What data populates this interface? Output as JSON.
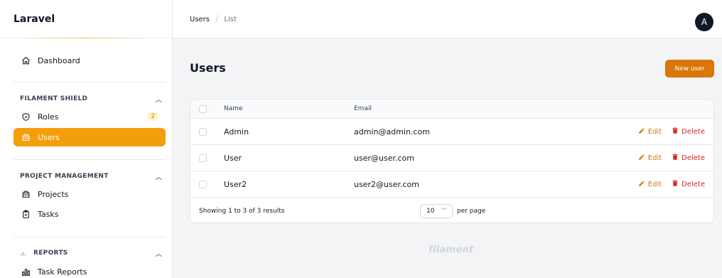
{
  "brand": "Laravel",
  "sidebar": {
    "dashboard": {
      "label": "Dashboard",
      "icon": "home-icon"
    },
    "groups": [
      {
        "title": "FILAMENT SHIELD",
        "items": [
          {
            "label": "Roles",
            "icon": "shield-icon",
            "badge": "2",
            "active": false
          },
          {
            "label": "Users",
            "icon": "folder-icon",
            "active": true
          }
        ]
      },
      {
        "title": "PROJECT MANAGEMENT",
        "items": [
          {
            "label": "Projects",
            "icon": "folder-icon"
          },
          {
            "label": "Tasks",
            "icon": "clipboard-check-icon"
          }
        ]
      },
      {
        "title": "REPORTS",
        "items": [
          {
            "label": "Task Reports",
            "icon": "chart-bar-icon"
          }
        ]
      }
    ]
  },
  "topbar": {
    "breadcrumb": [
      "Users",
      "List"
    ],
    "avatar_initial": "A"
  },
  "main": {
    "title": "Users",
    "new_button": "New user",
    "table": {
      "columns": [
        "Name",
        "Email"
      ],
      "rows": [
        {
          "name": "Admin",
          "email": "admin@admin.com"
        },
        {
          "name": "User",
          "email": "user@user.com"
        },
        {
          "name": "User2",
          "email": "user2@user.com"
        }
      ],
      "actions": {
        "edit": "Edit",
        "delete": "Delete"
      },
      "footer": {
        "showing": "Showing 1 to 3 of 3 results",
        "per_page_value": "10",
        "per_page_label": "per page"
      }
    },
    "watermark": "filament"
  },
  "colors": {
    "accent": "#f59e0b",
    "primary_button": "#d97706",
    "danger": "#dc2626"
  }
}
